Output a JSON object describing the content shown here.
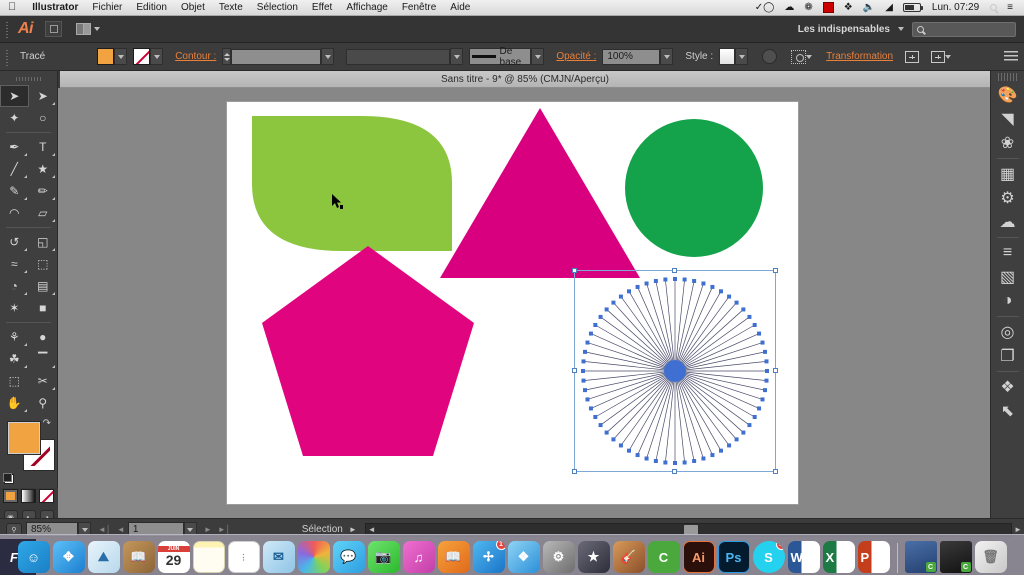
{
  "menubar": {
    "apple": "apple-logo",
    "items": [
      {
        "label": "Illustrator",
        "bold": true
      },
      {
        "label": "Fichier",
        "bold": false
      },
      {
        "label": "Edition",
        "bold": false
      },
      {
        "label": "Objet",
        "bold": false
      },
      {
        "label": "Texte",
        "bold": false
      },
      {
        "label": "Sélection",
        "bold": false
      },
      {
        "label": "Effet",
        "bold": false
      },
      {
        "label": "Affichage",
        "bold": false
      },
      {
        "label": "Fenêtre",
        "bold": false
      },
      {
        "label": "Aide",
        "bold": false
      }
    ],
    "status_icons": [
      "checkmark-circle-icon",
      "cloud-icon",
      "dropbox-grey-icon",
      "screen-record-icon",
      "dropbox-icon",
      "volume-icon",
      "wifi-icon",
      "battery-icon"
    ],
    "clock": "Lun. 07:29",
    "right_icons": [
      "spotlight-search-icon",
      "notification-center-icon"
    ]
  },
  "appbar": {
    "logo": "Ai",
    "bridge_label": "go-to-bridge-button",
    "arrange_label": "arrange-documents-button",
    "workspace": "Les indispensables",
    "search_placeholder": ""
  },
  "controlbar": {
    "path_label": "Tracé",
    "fill_color": "#f2a341",
    "stroke_color": "none",
    "stroke_label": "Contour :",
    "stroke_weight": "",
    "stroke_profile": "De base",
    "opacity_label": "Opacité :",
    "opacity_value": "100%",
    "style_label": "Style :",
    "transform_label": "Transformation",
    "align_label": "align-button",
    "panel_menu": "panel-menu-icon"
  },
  "document": {
    "tab_title": "Sans titre - 9* @ 85% (CMJN/Aperçu)"
  },
  "toolbox": {
    "tools": [
      {
        "name": "selection-tool",
        "glyph": "➤",
        "active": true,
        "corner": false
      },
      {
        "name": "direct-selection-tool",
        "glyph": "➤",
        "active": false,
        "corner": true
      },
      {
        "name": "magic-wand-tool",
        "glyph": "✦",
        "active": false,
        "corner": false
      },
      {
        "name": "lasso-tool",
        "glyph": "◌",
        "active": false,
        "corner": false
      },
      {
        "name": "pen-tool",
        "glyph": "✒",
        "active": false,
        "corner": true
      },
      {
        "name": "type-tool",
        "glyph": "T",
        "active": false,
        "corner": true
      },
      {
        "name": "line-segment-tool",
        "glyph": "╱",
        "active": false,
        "corner": true
      },
      {
        "name": "shape-tool",
        "glyph": "★",
        "active": false,
        "corner": true
      },
      {
        "name": "paintbrush-tool",
        "glyph": "✎",
        "active": false,
        "corner": true
      },
      {
        "name": "pencil-tool",
        "glyph": "✏",
        "active": false,
        "corner": true
      },
      {
        "name": "blob-brush-tool",
        "glyph": "◠",
        "active": false,
        "corner": false
      },
      {
        "name": "eraser-tool",
        "glyph": "▱",
        "active": false,
        "corner": true
      },
      {
        "name": "rotate-tool",
        "glyph": "↺",
        "active": false,
        "corner": true
      },
      {
        "name": "scale-tool",
        "glyph": "◱",
        "active": false,
        "corner": true
      },
      {
        "name": "width-tool",
        "glyph": "≈",
        "active": false,
        "corner": true
      },
      {
        "name": "free-transform-tool",
        "glyph": "⬚",
        "active": false,
        "corner": false
      },
      {
        "name": "shape-builder-tool",
        "glyph": "◔",
        "active": false,
        "corner": true
      },
      {
        "name": "perspective-grid-tool",
        "glyph": "▤",
        "active": false,
        "corner": true
      },
      {
        "name": "mesh-tool",
        "glyph": "✶",
        "active": false,
        "corner": false
      },
      {
        "name": "gradient-tool",
        "glyph": "■",
        "active": false,
        "corner": false
      },
      {
        "name": "eyedropper-tool",
        "glyph": "⚗",
        "active": false,
        "corner": true
      },
      {
        "name": "blend-tool",
        "glyph": "●",
        "active": false,
        "corner": false
      },
      {
        "name": "symbol-sprayer-tool",
        "glyph": "☘",
        "active": false,
        "corner": true
      },
      {
        "name": "column-graph-tool",
        "glyph": "█",
        "active": false,
        "corner": true
      },
      {
        "name": "artboard-tool",
        "glyph": "⬚",
        "active": false,
        "corner": false
      },
      {
        "name": "slice-tool",
        "glyph": "✂",
        "active": false,
        "corner": true
      },
      {
        "name": "hand-tool",
        "glyph": "✋",
        "active": false,
        "corner": true
      },
      {
        "name": "zoom-tool",
        "glyph": "⚲",
        "active": false,
        "corner": false
      }
    ],
    "fill_color": "#f2a341",
    "stroke_color": "none",
    "mini_swatches": [
      "color-swatch",
      "gradient-swatch",
      "none-swatch"
    ],
    "screen_modes": [
      "normal-screen-mode",
      "full-screen-menu-mode",
      "full-screen-mode"
    ],
    "change_screen_mode": "change-screen-mode-button"
  },
  "canvas": {
    "background": "#878787",
    "artboard_background": "#ffffff",
    "shapes": [
      {
        "name": "leaf-shape",
        "type": "leaf",
        "color": "#8cc63e"
      },
      {
        "name": "triangle-shape",
        "type": "triangle",
        "color": "#d9007f"
      },
      {
        "name": "circle-shape",
        "type": "circle",
        "color": "#14a34a"
      },
      {
        "name": "pentagon-shape",
        "type": "pentagon",
        "color": "#e0047f"
      },
      {
        "name": "starburst-shape",
        "type": "radial-burst",
        "color": "#4a4a6a",
        "selected": true
      }
    ],
    "selection_color": "#7fa8d4",
    "anchor_color": "#3f6fd0"
  },
  "statusbar": {
    "zoom_level": "85%",
    "page_number": "1",
    "status_text": "Sélection"
  },
  "rightdock": {
    "panels": [
      {
        "name": "color-panel-icon",
        "glyph": "◕"
      },
      {
        "name": "color-guide-panel-icon",
        "glyph": "◥"
      },
      {
        "name": "symbols-panel-icon",
        "glyph": "❀"
      },
      {
        "name": "swatches-panel-icon",
        "glyph": "▦"
      },
      {
        "name": "brushes-panel-icon",
        "glyph": "☙"
      },
      {
        "name": "graphic-styles-panel-icon",
        "glyph": "☁"
      },
      {
        "name": "stroke-panel-icon",
        "glyph": "≡"
      },
      {
        "name": "gradient-panel-icon",
        "glyph": "▧"
      },
      {
        "name": "transparency-panel-icon",
        "glyph": "◑"
      },
      {
        "name": "appearance-panel-icon",
        "glyph": "◎"
      },
      {
        "name": "pathfinder-panel-icon",
        "glyph": "❐"
      },
      {
        "name": "layers-panel-icon",
        "glyph": "≡"
      },
      {
        "name": "artboards-panel-icon",
        "glyph": "⧉"
      }
    ]
  },
  "dock": {
    "items": [
      {
        "name": "finder-icon",
        "label": "",
        "running": true
      },
      {
        "name": "safari-icon",
        "label": "",
        "running": true
      },
      {
        "name": "preview-icon",
        "label": "",
        "running": false
      },
      {
        "name": "contacts-icon",
        "label": "",
        "running": false
      },
      {
        "name": "calendar-icon",
        "label": "29",
        "running": false
      },
      {
        "name": "notes-icon",
        "label": "",
        "running": false
      },
      {
        "name": "reminders-icon",
        "label": "",
        "running": false
      },
      {
        "name": "mail-icon",
        "label": "",
        "running": false
      },
      {
        "name": "photos-icon",
        "label": "",
        "running": false
      },
      {
        "name": "messages-icon",
        "label": "",
        "running": false
      },
      {
        "name": "facetime-icon",
        "label": "",
        "running": false
      },
      {
        "name": "itunes-icon",
        "label": "",
        "running": false
      },
      {
        "name": "ibooks-icon",
        "label": "",
        "running": false
      },
      {
        "name": "app-store-icon",
        "label": "",
        "running": false,
        "badge": "1"
      },
      {
        "name": "dropbox-icon",
        "label": "",
        "running": false
      },
      {
        "name": "system-preferences-icon",
        "label": "",
        "running": false
      },
      {
        "name": "imovie-icon",
        "label": "",
        "running": false
      },
      {
        "name": "garageband-icon",
        "label": "",
        "running": false
      },
      {
        "name": "camtasia-icon",
        "label": "C",
        "running": true
      },
      {
        "name": "illustrator-icon",
        "label": "Ai",
        "running": true
      },
      {
        "name": "photoshop-icon",
        "label": "Ps",
        "running": true
      },
      {
        "name": "skype-icon",
        "label": "S",
        "running": true,
        "badge": "1"
      },
      {
        "name": "word-icon",
        "label": "W",
        "running": true
      },
      {
        "name": "excel-icon",
        "label": "X",
        "running": true
      },
      {
        "name": "powerpoint-icon",
        "label": "P",
        "running": true
      }
    ],
    "minimized": [
      {
        "name": "minimized-window-1",
        "label": "C"
      },
      {
        "name": "minimized-window-2",
        "label": "C"
      }
    ],
    "trash": "trash-icon",
    "corner_window_label": "Fo"
  }
}
